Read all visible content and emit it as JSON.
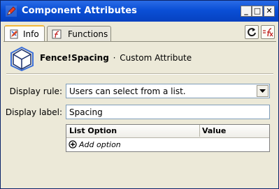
{
  "window": {
    "title": "Component Attributes",
    "controls": {
      "minimize": "_",
      "maximize": "□",
      "close": "✕"
    }
  },
  "tabs": [
    {
      "label": "Info",
      "active": true
    },
    {
      "label": "Functions",
      "active": false
    }
  ],
  "component": {
    "name": "Fence!Spacing",
    "separator": "·",
    "type": "Custom Attribute"
  },
  "form": {
    "display_rule_label": "Display rule:",
    "display_rule_value": "Users can select from a list.",
    "display_label_label": "Display label:",
    "display_label_value": "Spacing"
  },
  "options_table": {
    "columns": [
      "List Option",
      "Value"
    ],
    "add_option_label": "Add option"
  },
  "colors": {
    "titlebar": "#0a4fd6",
    "window_bg": "#ece9d8",
    "active_tab_accent": "#f2b83b"
  }
}
